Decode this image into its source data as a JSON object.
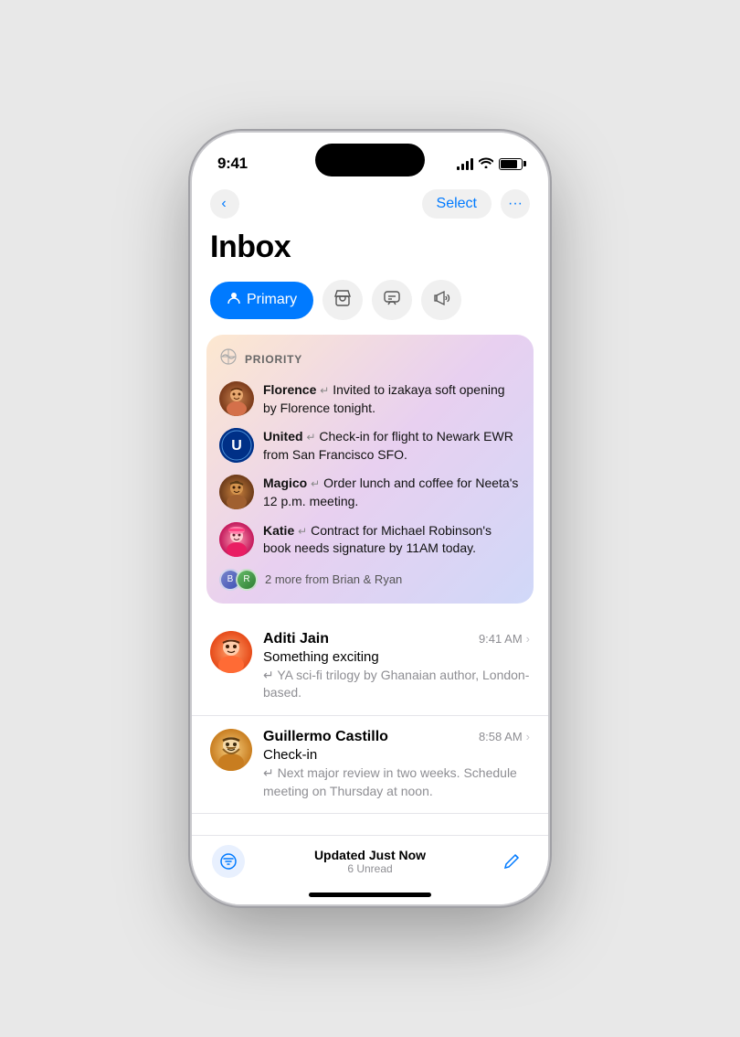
{
  "statusBar": {
    "time": "9:41"
  },
  "navBar": {
    "backLabel": "‹",
    "selectLabel": "Select",
    "moreLabel": "···"
  },
  "page": {
    "title": "Inbox"
  },
  "filterTabs": {
    "primary": "Primary",
    "primaryIcon": "👤",
    "shoppingIcon": "🛒",
    "messagesIcon": "💬",
    "promotionsIcon": "📢"
  },
  "priority": {
    "label": "PRIORITY",
    "emoji": "🌐",
    "items": [
      {
        "sender": "Florence",
        "text": "Invited to izakaya soft opening by Florence tonight."
      },
      {
        "sender": "United",
        "text": "Check-in for flight to Newark EWR from San Francisco SFO."
      },
      {
        "sender": "Magico",
        "text": "Order lunch and coffee for Neeta's 12 p.m. meeting."
      },
      {
        "sender": "Katie",
        "text": "Contract for Michael Robinson's book needs signature by 11AM today."
      }
    ],
    "moreText": "2 more from Brian & Ryan"
  },
  "emails": [
    {
      "sender": "Aditi Jain",
      "time": "9:41 AM",
      "subject": "Something exciting",
      "preview": "↵ YA sci-fi trilogy by Ghanaian author, London-based."
    },
    {
      "sender": "Guillermo Castillo",
      "time": "8:58 AM",
      "subject": "Check-in",
      "preview": "↵ Next major review in two weeks. Schedule meeting on Thursday at noon."
    }
  ],
  "bottomBar": {
    "updatedText": "Updated Just Now",
    "unreadText": "6 Unread"
  }
}
